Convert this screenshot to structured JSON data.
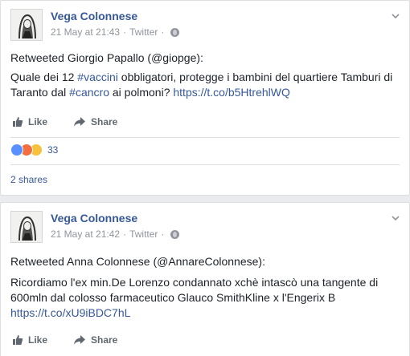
{
  "posts": [
    {
      "author": "Vega Colonnese",
      "timestamp": "21 May at 21:43",
      "source": "Twitter",
      "meta_separator": "·",
      "retweet_line": "Retweeted Giorgio Papallo (@giopge):",
      "body": {
        "t1": "Quale dei 12 ",
        "h1": "#vaccini",
        "t2": " obbligatori, protegge i bambini del quartiere Tamburi di Taranto dal ",
        "h2": "#cancro",
        "t3": " ai polmoni? ",
        "link": "https://t.co/b5HtrehlWQ"
      },
      "actions": {
        "like": "Like",
        "share": "Share"
      },
      "reactions": {
        "count": "33",
        "types": [
          "like",
          "angry",
          "sad"
        ]
      },
      "shares": "2 shares"
    },
    {
      "author": "Vega Colonnese",
      "timestamp": "21 May at 21:42",
      "source": "Twitter",
      "meta_separator": "·",
      "retweet_line": "Retweeted Anna Colonnese (@AnnareColonnese):",
      "body": {
        "t1": "Ricordiamo l'ex min.De Lorenzo condannato xchè intascò una tangente di 600mln dal colosso farmaceutico Glauco SmithKline x l'Engerix B ",
        "link": "https://t.co/xU9iBDC7hL"
      },
      "actions": {
        "like": "Like",
        "share": "Share"
      }
    }
  ],
  "colors": {
    "link": "#365899",
    "muted": "#90949c",
    "like_reaction": "#5890ff",
    "angry_reaction": "#f26e3e",
    "sad_reaction": "#f7c13b"
  },
  "icons": [
    "chevron-down-icon",
    "globe-icon",
    "thumbs-up-icon",
    "share-arrow-icon"
  ]
}
